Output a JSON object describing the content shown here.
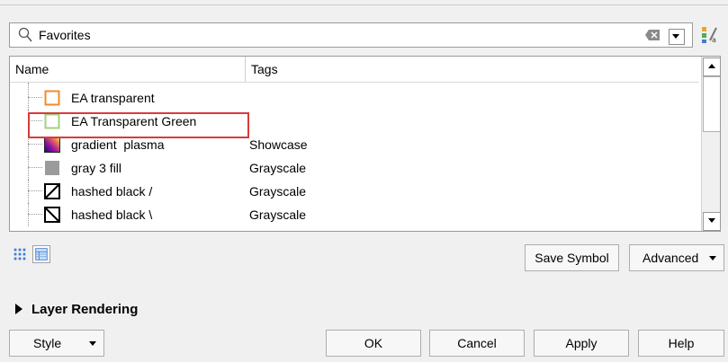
{
  "search": {
    "value": "Favorites"
  },
  "table": {
    "columns": [
      "Name",
      "Tags"
    ],
    "rows": [
      {
        "name": "EA transparent",
        "tag": "",
        "symbol": "outline-square-orange-icon"
      },
      {
        "name": "EA Transparent Green",
        "tag": "",
        "symbol": "outline-square-green-icon"
      },
      {
        "name": "gradient  plasma",
        "tag": "Showcase",
        "symbol": "gradient-plasma-icon"
      },
      {
        "name": "gray 3 fill",
        "tag": "Grayscale",
        "symbol": "gray-fill-icon"
      },
      {
        "name": "hashed black /",
        "tag": "Grayscale",
        "symbol": "hatch-forward-icon"
      },
      {
        "name": "hashed black \\",
        "tag": "Grayscale",
        "symbol": "hatch-back-icon"
      }
    ]
  },
  "buttons": {
    "save_symbol": "Save Symbol",
    "advanced": "Advanced",
    "style": "Style",
    "ok": "OK",
    "cancel": "Cancel",
    "apply": "Apply",
    "help": "Help"
  },
  "section": {
    "layer_rendering": "Layer Rendering"
  },
  "colors": {
    "highlight": "#d93a3a",
    "orange_outline": "#f28c28",
    "green_outline": "#a3d27a",
    "gray_fill": "#9b9b9b"
  }
}
